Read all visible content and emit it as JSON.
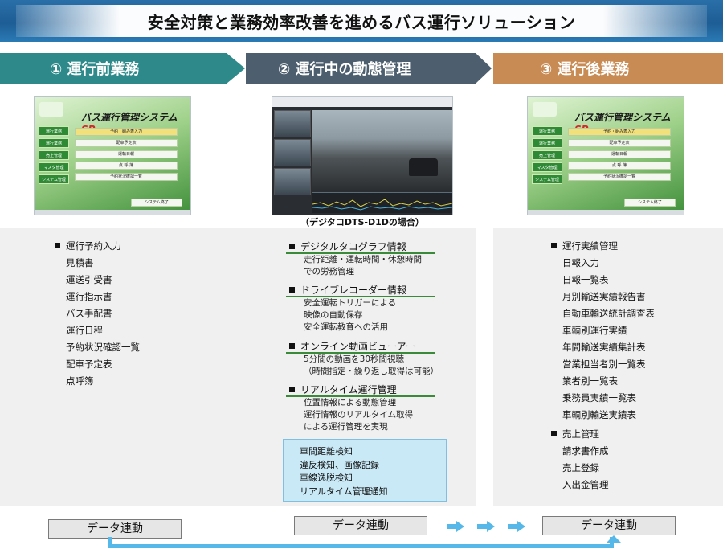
{
  "banner": {
    "title": "安全対策と業務効率改善を進めるバス運行ソリューション"
  },
  "phases": [
    {
      "label": "① 運行前業務",
      "color": "#2e8a8a"
    },
    {
      "label": "② 運行中の動態管理",
      "color": "#4d5f6e"
    },
    {
      "label": "③ 運行後業務",
      "color": "#c98b54"
    }
  ],
  "app_screen": {
    "title_main": "バス運行管理システム",
    "title_suffix": "SP",
    "side_buttons": [
      "運行業務",
      "運行業務",
      "売上管理",
      "マスタ管理",
      "システム管理"
    ],
    "menu_items": [
      "予約・組み表入力",
      "配車予定表",
      "運転日報",
      "点 呼 簿",
      "予約状況確認一覧"
    ],
    "end_button": "システム終了"
  },
  "viewer_caption": "（デジタコDTS-D1Dの場合）",
  "pre_trip_list": [
    "運行予約入力",
    "見積書",
    "運送引受書",
    "運行指示書",
    "バス手配書",
    "運行日程",
    "予約状況確認一覧",
    "配車予定表",
    "点呼簿"
  ],
  "in_trip": {
    "sections": [
      {
        "title": "デジタルタコグラフ情報",
        "lines": [
          "走行距離・運転時間・休憩時間",
          "での労務管理"
        ]
      },
      {
        "title": "ドライブレコーダー情報",
        "lines": [
          "安全運転トリガーによる",
          "映像の自動保存",
          "安全運転教育への活用"
        ]
      },
      {
        "title": "オンライン動画ビューアー",
        "lines": [
          "5分間の動画を30秒間視聴",
          "（時間指定・繰り返し取得は可能）"
        ]
      },
      {
        "title": "リアルタイム運行管理",
        "lines": [
          "位置情報による動態管理",
          "運行情報のリアルタイム取得",
          "による運行管理を実現"
        ]
      }
    ],
    "alerts": [
      "車間距離検知",
      "違反検知、画像記録",
      "車線逸脱検知",
      "リアルタイム管理通知"
    ]
  },
  "post_trip": {
    "group1": [
      "運行実績管理",
      "日報入力",
      "日報一覧表",
      "月別輸送実績報告書",
      "自動車輸送統計調査表",
      "車輌別運行実績",
      "年間輸送実績集計表",
      "営業担当者別一覧表",
      "業者別一覧表",
      "乗務員実績一覧表",
      "車輌別輸送実績表"
    ],
    "group2": [
      "売上管理",
      "請求書作成",
      "売上登録",
      "入出金管理"
    ]
  },
  "data_link": {
    "label": "データ連動",
    "arrow_color": "#55b8e8"
  }
}
